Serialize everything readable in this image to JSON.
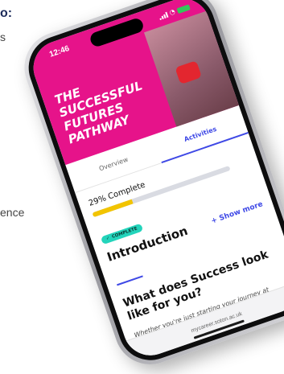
{
  "background": {
    "heading_fragment": "o:",
    "line_1_fragment": "s",
    "line_2_fragment": "ence"
  },
  "phone": {
    "status_time": "12:46",
    "hero_title": "THE SUCCESSFUL FUTURES PATHWAY",
    "tabs": [
      {
        "label": "Overview",
        "active": false
      },
      {
        "label": "Activities",
        "active": true
      }
    ],
    "progress": {
      "label": "29% Complete",
      "percent": 29
    },
    "badge": "COMPLETE",
    "section_title": "Introduction",
    "show_more": "Show more",
    "question_title": "What does Success look like for you?",
    "question_body": "Whether you're just starting your journey at university or approaching graduation, it's time to think about what success means for YOU.",
    "url": "mycareer.soton.ac.uk"
  },
  "colors": {
    "hero": "#e6138a",
    "accent": "#3f49e6",
    "progress_fill": "#f2c400",
    "badge": "#23d4bb"
  }
}
